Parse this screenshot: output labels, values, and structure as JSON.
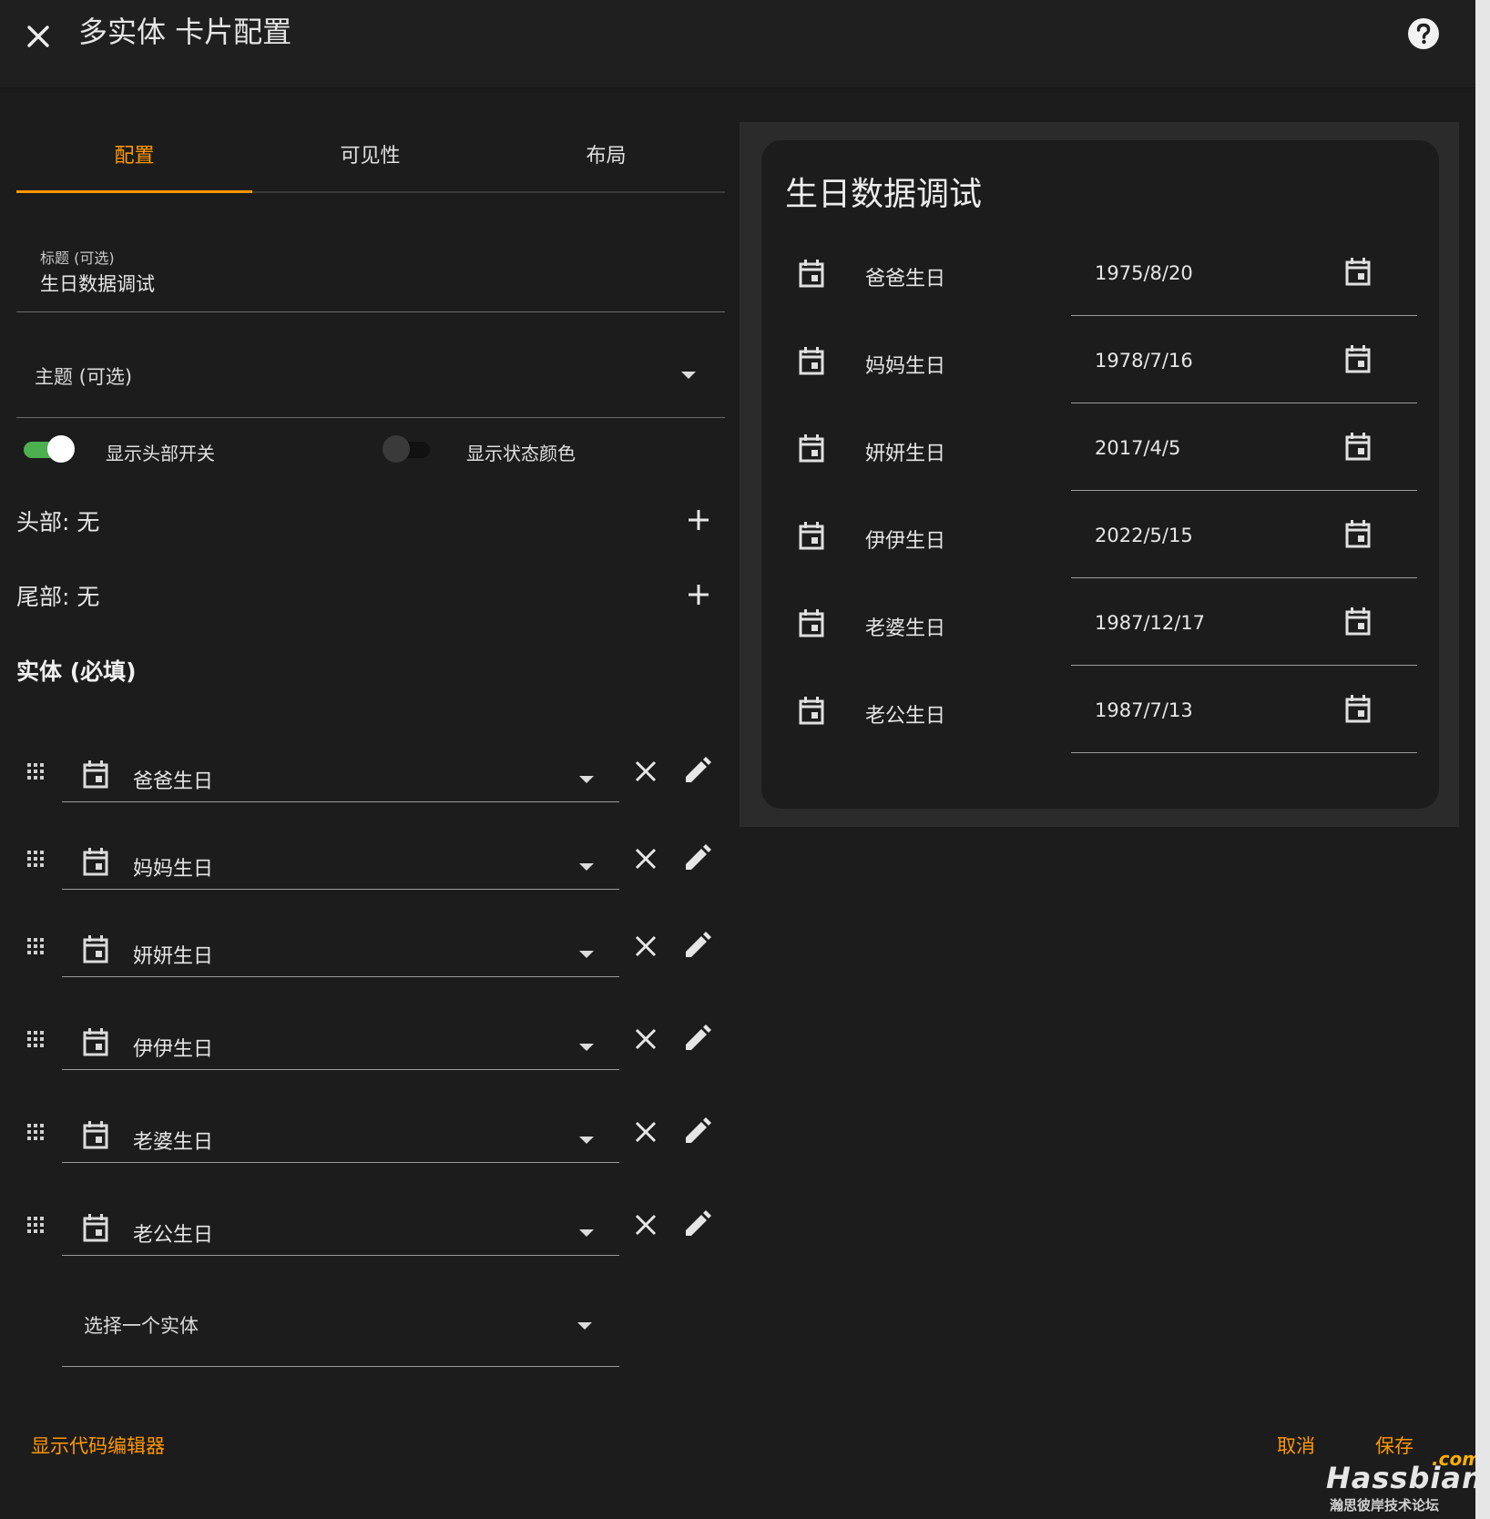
{
  "dialog": {
    "title": "多实体 卡片配置",
    "close_icon": "close-icon",
    "help_icon": "help-circle-icon"
  },
  "tabs": [
    {
      "label": "配置",
      "active": true
    },
    {
      "label": "可见性",
      "active": false
    },
    {
      "label": "布局",
      "active": false
    }
  ],
  "form": {
    "title_label": "标题 (可选)",
    "title_value": "生日数据调试",
    "theme_label": "主题 (可选)",
    "show_header_toggle_label": "显示头部开关",
    "show_header_toggle_on": true,
    "state_color_label": "显示状态颜色",
    "state_color_on": false,
    "header_label": "头部: 无",
    "footer_label": "尾部: 无",
    "entities_title": "实体 (必填)",
    "entities": [
      {
        "name": "爸爸生日"
      },
      {
        "name": "妈妈生日"
      },
      {
        "name": "妍妍生日"
      },
      {
        "name": "伊伊生日"
      },
      {
        "name": "老婆生日"
      },
      {
        "name": "老公生日"
      }
    ],
    "pick_entity_label": "选择一个实体"
  },
  "footer": {
    "code_editor_label": "显示代码编辑器",
    "cancel_label": "取消",
    "save_label": "保存"
  },
  "preview": {
    "card_title": "生日数据调试",
    "rows": [
      {
        "name": "爸爸生日",
        "date": "1975/8/20"
      },
      {
        "name": "妈妈生日",
        "date": "1978/7/16"
      },
      {
        "name": "妍妍生日",
        "date": "2017/4/5"
      },
      {
        "name": "伊伊生日",
        "date": "2022/5/15"
      },
      {
        "name": "老婆生日",
        "date": "1987/12/17"
      },
      {
        "name": "老公生日",
        "date": "1987/7/13"
      }
    ]
  },
  "watermark": {
    "com": ".com",
    "brand": "Hassbian",
    "subtitle": "瀚思彼岸技术论坛"
  },
  "colors": {
    "accent": "#ff9800",
    "switch_on": "#4caf50",
    "background": "#1c1c1c"
  }
}
